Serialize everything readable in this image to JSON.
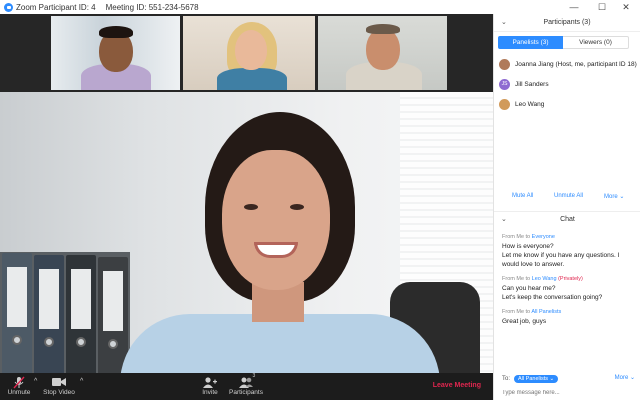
{
  "titlebar": {
    "participant_id": "Zoom Participant ID: 4",
    "meeting_id": "Meeting ID: 551-234-5678",
    "minimize_glyph": "—",
    "maximize_glyph": "☐",
    "close_glyph": "✕"
  },
  "toolbar": {
    "unmute_label": "Unmute",
    "stop_video_label": "Stop Video",
    "invite_label": "Invite",
    "participants_label": "Participants",
    "participants_count": "3",
    "leave_label": "Leave Meeting",
    "caret_glyph": "^"
  },
  "participants": {
    "title": "Participants (3)",
    "collapse_glyph": "⌄",
    "tabs": {
      "panelists": "Panelists (3)",
      "viewers": "Viewers (0)"
    },
    "items": [
      {
        "name": "Joanna Jiang (Host, me, participant ID 18)",
        "avatar_initials": "",
        "avatar_color": "#b07a5a"
      },
      {
        "name": "Jill Sanders",
        "avatar_initials": "JS",
        "avatar_color": "#8e6bd1"
      },
      {
        "name": "Leo Wang",
        "avatar_initials": "",
        "avatar_color": "#d19a5a"
      }
    ],
    "actions": {
      "mute_all": "Mute All",
      "unmute_all": "Unmute All",
      "more": "More ⌄"
    }
  },
  "chat": {
    "title": "Chat",
    "collapse_glyph": "⌄",
    "messages": [
      {
        "from": "From Me to ",
        "to": "Everyone",
        "private": "",
        "lines": [
          "How is everyone?",
          "Let me know if you have any questions. I would love to answer."
        ]
      },
      {
        "from": "From Me to ",
        "to": "Leo Wang",
        "private": "(Privately)",
        "lines": [
          "Can you hear me?",
          "Let's keep the conversation going?"
        ]
      },
      {
        "from": "From Me to ",
        "to": "All Panelists",
        "private": "",
        "lines": [
          "Great job, guys"
        ]
      }
    ],
    "to_label": "To:",
    "to_value": "All Panelists ⌄",
    "more_label": "More ⌄",
    "input_placeholder": "Type message here..."
  },
  "colors": {
    "accent": "#2d8cff",
    "leave": "#e0264f",
    "toolbar_bg": "#1c1c1c"
  }
}
